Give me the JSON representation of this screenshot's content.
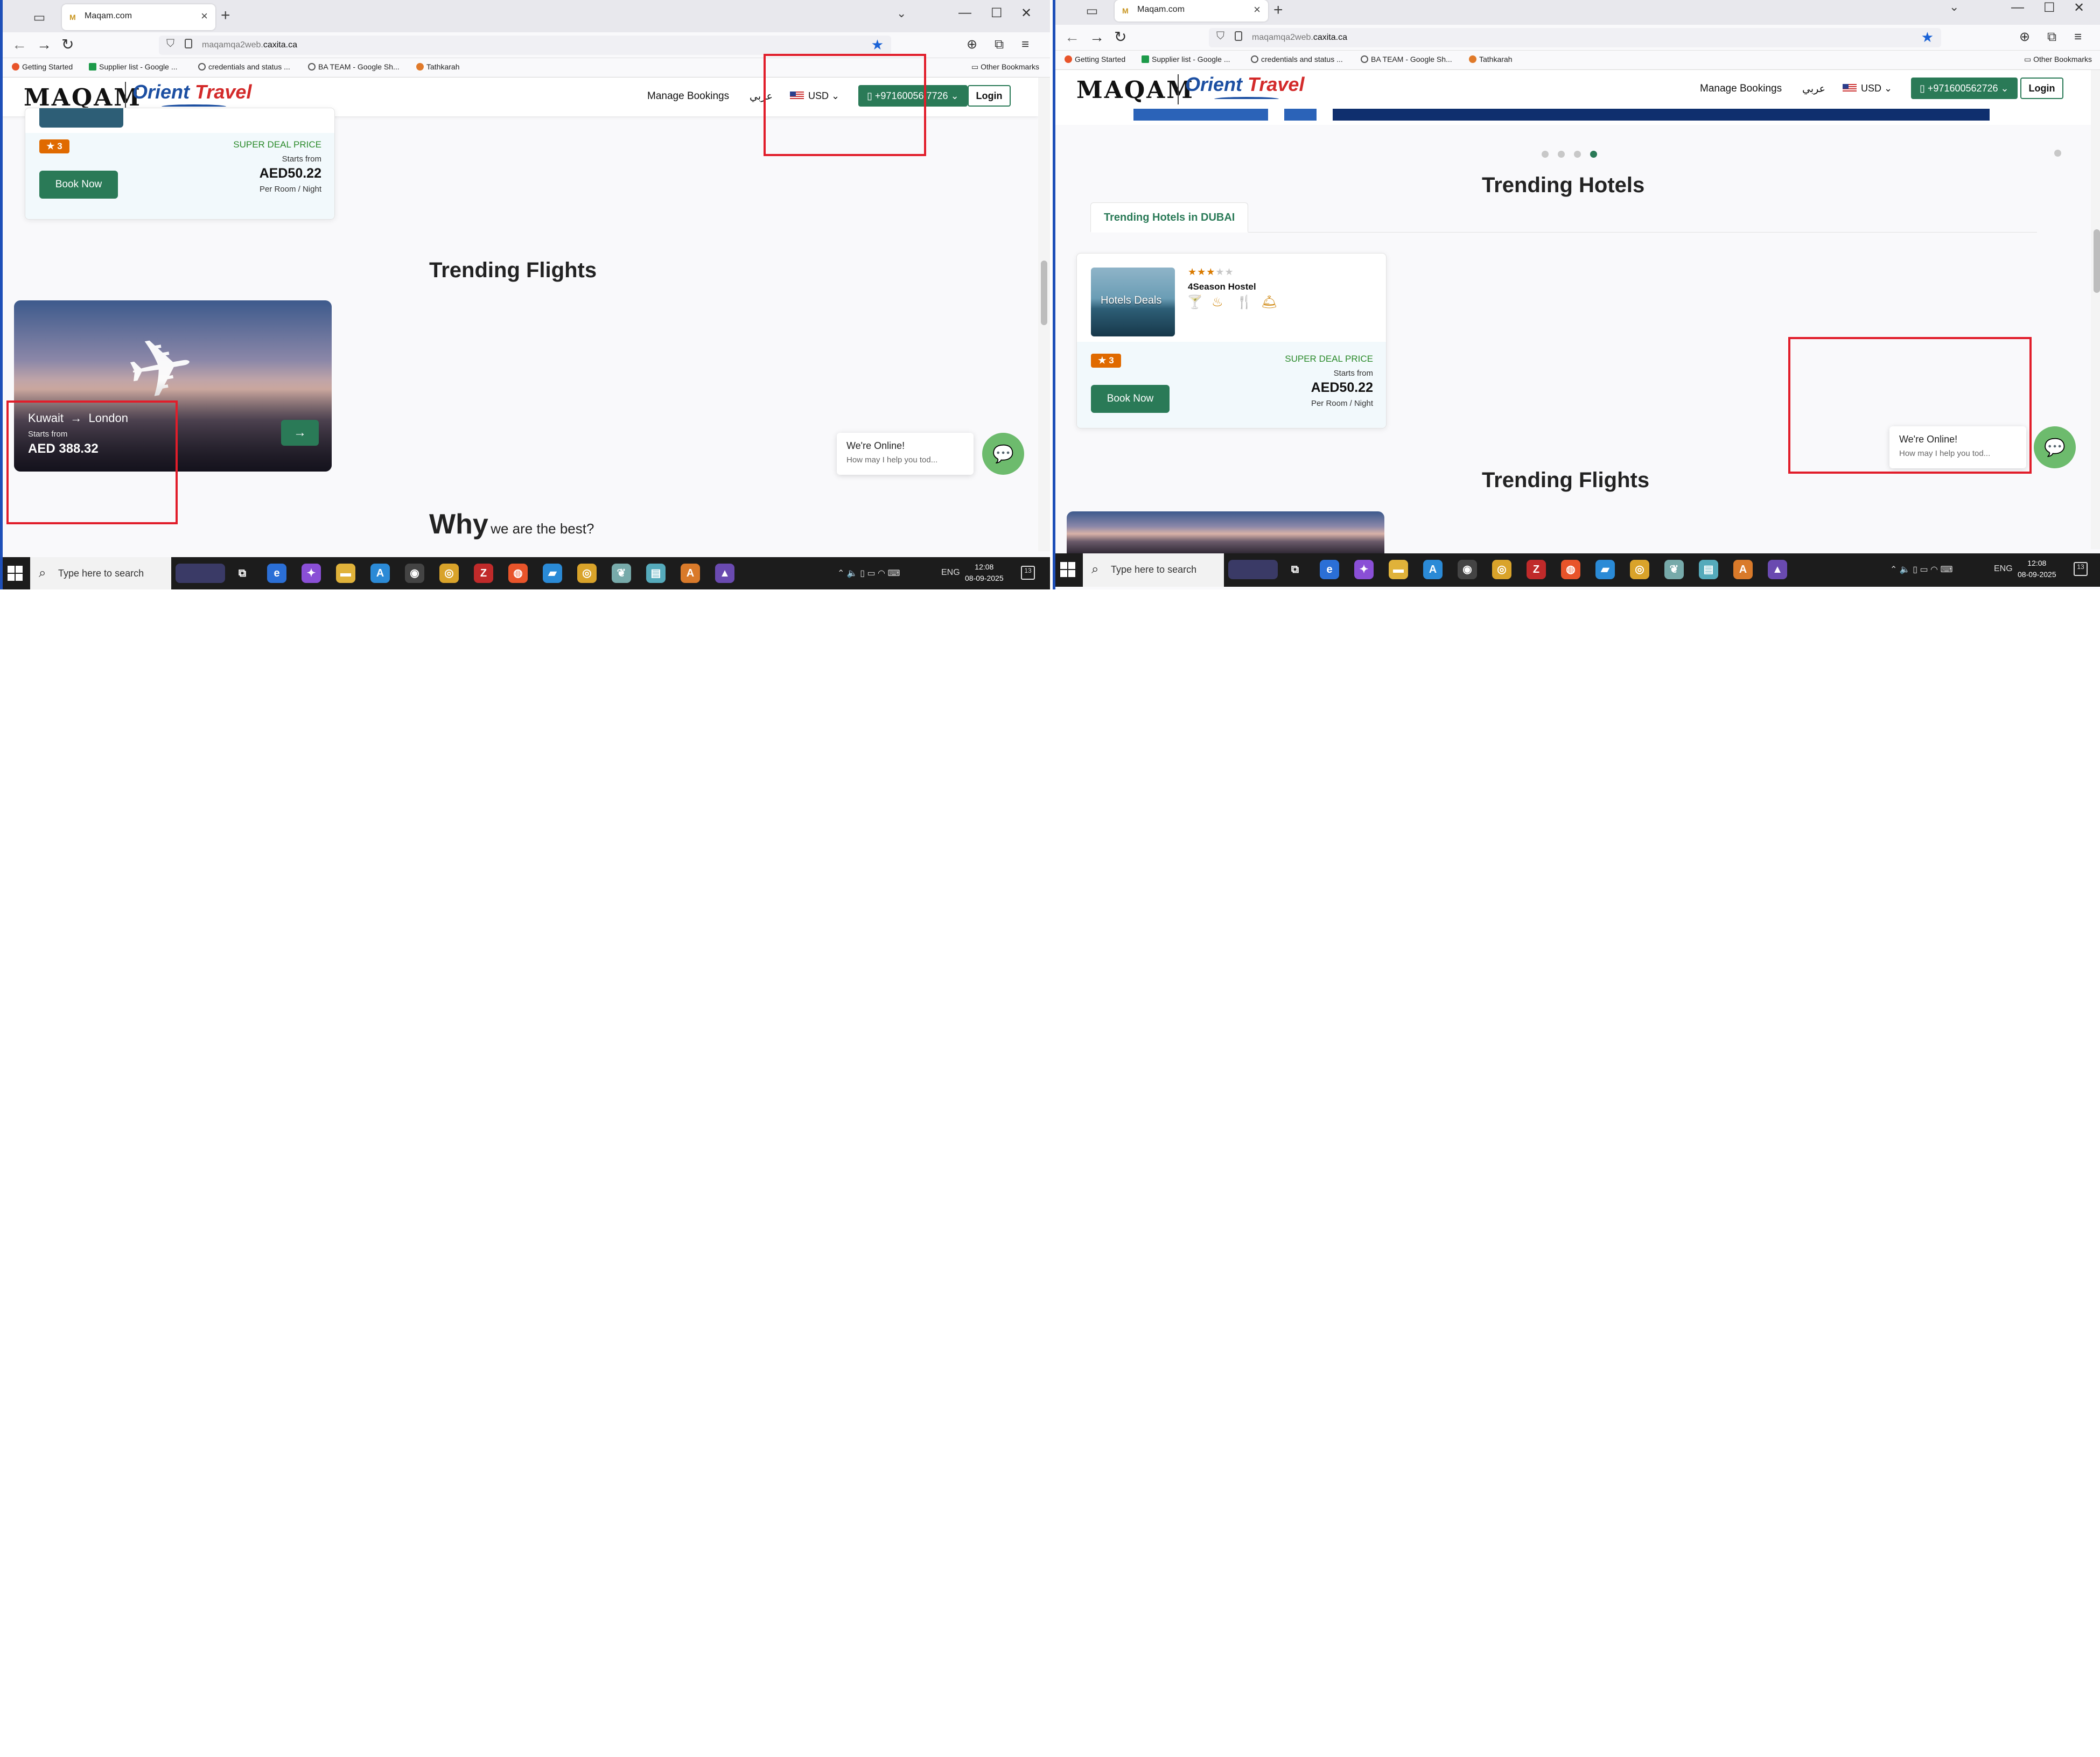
{
  "browser": {
    "tab_title": "Maqam.com",
    "favicon_text": "M",
    "new_tab": "+",
    "tab_close": "×",
    "url_host": "maqamqa2web.",
    "url_domain": "caxita.ca",
    "bookmarks": [
      "Getting Started",
      "Supplier list - Google ...",
      "credentials and status ...",
      "BA TEAM - Google Sh...",
      "Tathkarah"
    ],
    "other_bookmarks": "Other Bookmarks"
  },
  "site": {
    "logo_maqam": "MAQAM",
    "logo_orient": "Orient",
    "logo_travel": "Travel",
    "nav": {
      "manage_bookings": "Manage Bookings",
      "arabic": "عربي",
      "currency": "USD",
      "phone_left": "+97160056:7726",
      "phone_right": "+971600562726",
      "login": "Login"
    }
  },
  "hotel_card": {
    "rating_badge": "★ 3",
    "book_now": "Book Now",
    "deal_label": "SUPER DEAL PRICE",
    "starts_from": "Starts from",
    "price": "AED50.22",
    "per_unit": "Per Room / Night",
    "hotel_name": "4Season Hostel",
    "thumb_label": "Hotels Deals",
    "stars_filled": "★★★",
    "stars_empty": "★★"
  },
  "sections": {
    "trending_flights": "Trending Flights",
    "trending_hotels": "Trending Hotels",
    "hotels_tab": "Trending Hotels in DUBAI",
    "why_big": "Why",
    "why_small": "we are the best?"
  },
  "flight_card": {
    "from": "Kuwait",
    "to": "London",
    "starts_from": "Starts from",
    "price": "AED 388.32",
    "arrow": "→"
  },
  "chat": {
    "title": "We're Online!",
    "subtitle": "How may I help you tod..."
  },
  "taskbar": {
    "search_placeholder": "Type here to search",
    "lang": "ENG",
    "time": "12:08",
    "date": "08-09-2025",
    "notification_count": "13"
  },
  "colors": {
    "brand_green": "#2a7a57",
    "deal_green": "#2a8a2a",
    "badge_orange": "#e06a00",
    "annotation_red": "#e11d2a",
    "orient_blue": "#1c4fa2"
  }
}
